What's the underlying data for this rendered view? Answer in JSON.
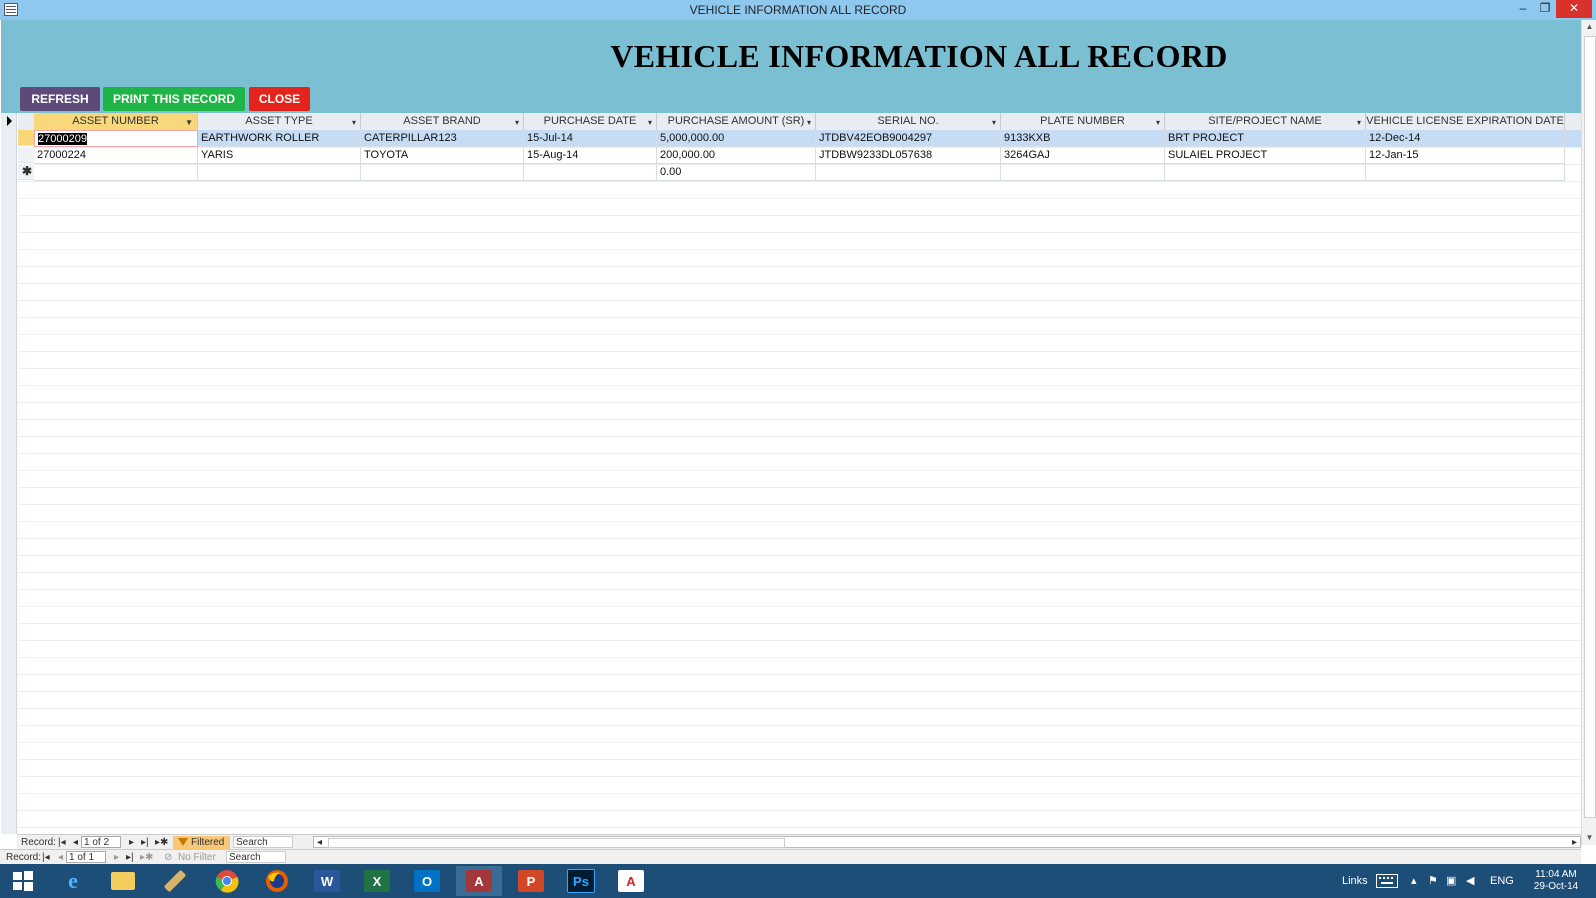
{
  "window": {
    "title": "VEHICLE INFORMATION ALL RECORD",
    "minimize": "–",
    "maximize": "❐",
    "close": "✕"
  },
  "form": {
    "title": "VEHICLE INFORMATION ALL RECORD",
    "buttons": {
      "refresh": "REFRESH",
      "print": "PRINT THIS RECORD",
      "close": "CLOSE"
    },
    "button_colors": {
      "refresh": "#5d4a79",
      "print": "#1fb446",
      "close": "#e5231d"
    }
  },
  "table": {
    "columns": [
      "ASSET NUMBER",
      "ASSET TYPE",
      "ASSET BRAND",
      "PURCHASE DATE",
      "PURCHASE AMOUNT (SR)",
      "SERIAL NO.",
      "PLATE NUMBER",
      "SITE/PROJECT  NAME",
      "VEHICLE LICENSE EXPIRATION DATE"
    ],
    "rows": [
      [
        "27000209",
        "EARTHWORK ROLLER",
        "CATERPILLAR123",
        "15-Jul-14",
        "5,000,000.00",
        "JTDBV42EOB9004297",
        "9133KXB",
        "BRT PROJECT",
        "12-Dec-14"
      ],
      [
        "27000224",
        "YARIS",
        "TOYOTA",
        "15-Aug-14",
        "200,000.00",
        "JTDBW9233DL057638",
        "3264GAJ",
        "SULAIEL PROJECT",
        "12-Jan-15"
      ]
    ],
    "new_row": {
      "marker": "✱",
      "amount": "0.00"
    }
  },
  "nav_inner": {
    "label": "Record:",
    "position": "1 of 2",
    "filter": "Filtered",
    "search": "Search"
  },
  "nav_outer": {
    "label": "Record:",
    "position": "1 of 1",
    "filter": "No Filter",
    "search": "Search"
  },
  "taskbar": {
    "apps": [
      "start-icon",
      "internet-explorer-icon",
      "file-explorer-icon",
      "tool-icon",
      "chrome-icon",
      "firefox-icon",
      "word-icon",
      "excel-icon",
      "outlook-icon",
      "access-icon",
      "powerpoint-icon",
      "photoshop-icon",
      "acrobat-icon"
    ],
    "links": "Links",
    "lang": "ENG",
    "time": "11:04 AM",
    "date": "29-Oct-14"
  }
}
